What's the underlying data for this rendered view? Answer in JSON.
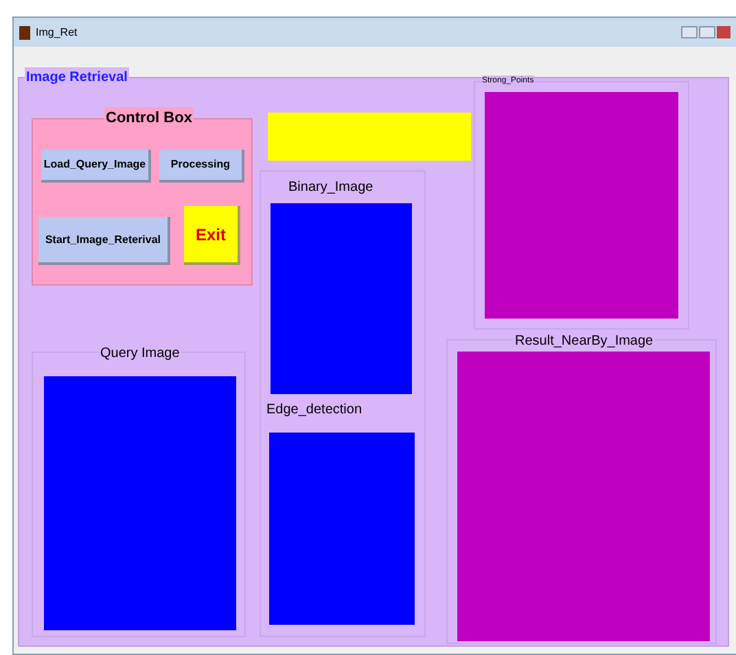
{
  "window": {
    "title": "Img_Ret"
  },
  "header": {
    "label": "Image Retrieval"
  },
  "control_box": {
    "title": "Control Box",
    "buttons": [
      {
        "label": "Load_Query_Image",
        "kind": "normal"
      },
      {
        "label": "Processing",
        "kind": "normal"
      },
      {
        "label": "Start_Image_Reterival",
        "kind": "normal"
      },
      {
        "label": "Exit",
        "kind": "exit"
      }
    ]
  },
  "panels": {
    "strong_points": "Strong_Points",
    "binary": "Binary_Image",
    "edge": "Edge_detection",
    "result": "Result_NearBy_Image",
    "query": "Query Image"
  }
}
